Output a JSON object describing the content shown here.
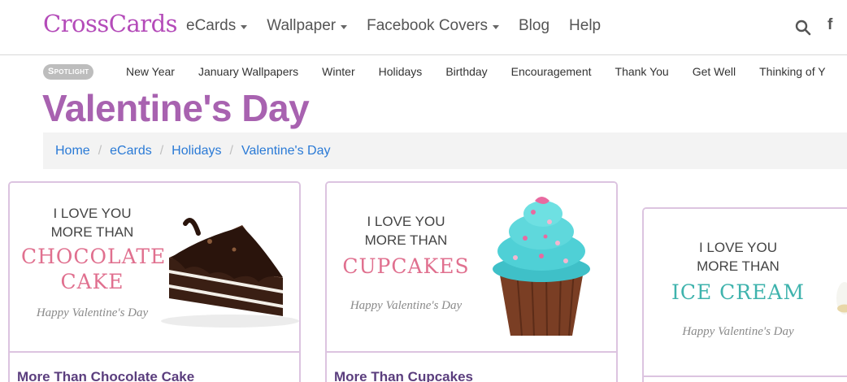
{
  "brand": {
    "logo_text": "CrossCards",
    "color": "#b44bb9"
  },
  "nav": {
    "items": [
      {
        "label": "eCards",
        "dropdown": true
      },
      {
        "label": "Wallpaper",
        "dropdown": true
      },
      {
        "label": "Facebook Covers",
        "dropdown": true
      },
      {
        "label": "Blog",
        "dropdown": false
      },
      {
        "label": "Help",
        "dropdown": false
      }
    ],
    "icons": [
      "search-icon",
      "facebook-icon"
    ],
    "facebook_glyph": "f"
  },
  "spotlight": {
    "badge": "Spotlight",
    "links": [
      "New Year",
      "January Wallpapers",
      "Winter",
      "Holidays",
      "Birthday",
      "Encouragement",
      "Thank You",
      "Get Well",
      "Thinking of Y"
    ]
  },
  "page": {
    "title": "Valentine's Day",
    "title_color": "#a862b0"
  },
  "breadcrumb": {
    "items": [
      "Home",
      "eCards",
      "Holidays",
      "Valentine's Day"
    ],
    "separator": "/",
    "link_color": "#2a7ad6"
  },
  "cards": [
    {
      "line1": "I LOVE YOU",
      "line2": "MORE THAN",
      "headline1": "CHOCOLATE",
      "headline2": "CAKE",
      "headline_color": "#e0708f",
      "footer": "Happy Valentine's Day",
      "title": "More Than Chocolate Cake"
    },
    {
      "line1": "I LOVE YOU",
      "line2": "MORE THAN",
      "headline1": "CUPCAKES",
      "headline_color": "#e0708f",
      "footer": "Happy Valentine's Day",
      "title": "More Than Cupcakes"
    },
    {
      "line1": "I LOVE YOU",
      "line2": "MORE THAN",
      "headline1": "ICE CREAM",
      "headline_color": "#3fb3ad",
      "footer": "Happy Valentine's Day",
      "title": ""
    }
  ]
}
